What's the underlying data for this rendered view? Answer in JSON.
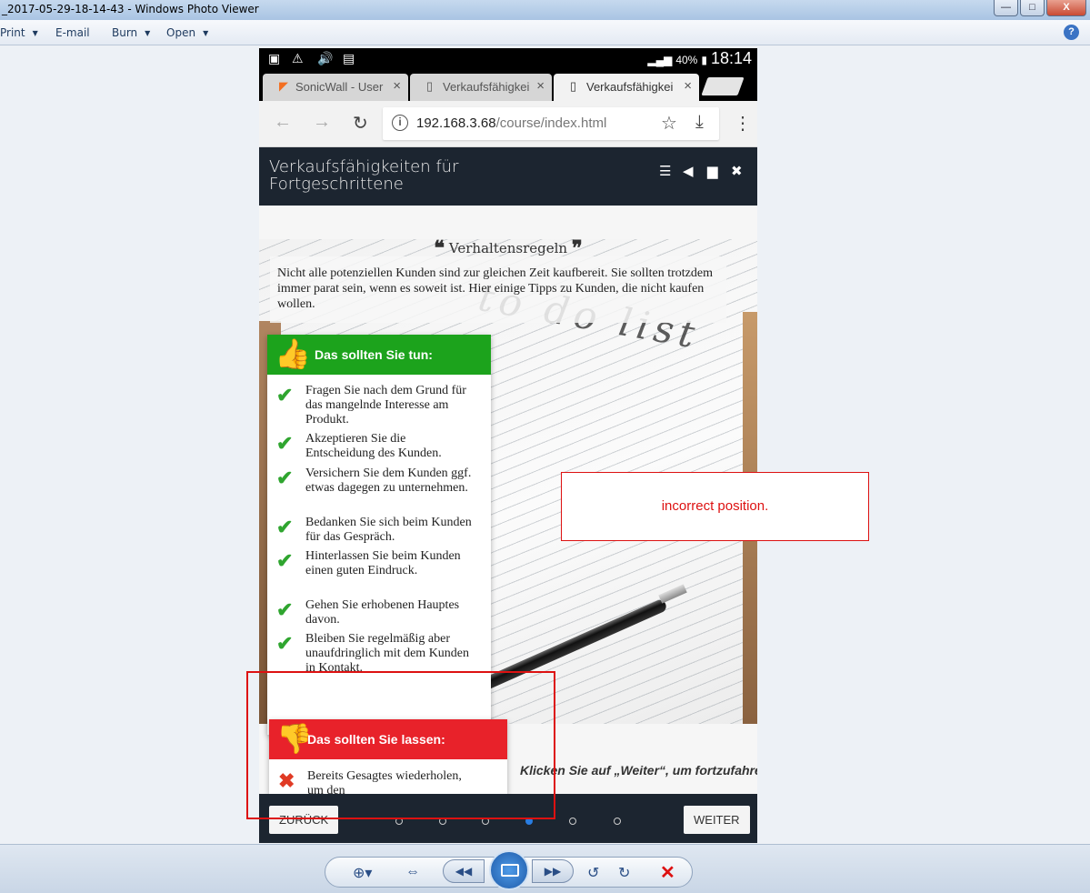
{
  "window": {
    "title": "_2017-05-29-18-14-43 - Windows Photo Viewer",
    "controls": {
      "minimize": "—",
      "maximize": "□",
      "close": "X"
    }
  },
  "menu": {
    "print": "Print",
    "email": "E-mail",
    "burn": "Burn",
    "open": "Open",
    "help": "?"
  },
  "phone": {
    "status": {
      "battery": "40%",
      "time": "18:14"
    },
    "tabs": [
      {
        "label": "SonicWall - User",
        "close": "×"
      },
      {
        "label": "Verkaufsfähigkei",
        "close": "×"
      },
      {
        "label": "Verkaufsfähigkei",
        "close": "×"
      }
    ],
    "address": {
      "host": "192.168.3.68",
      "path": "/course/index.html",
      "info": "i"
    },
    "course": {
      "title": "Verkaufsfähigkeiten für Fortgeschrittene",
      "quote_title": "Verhaltensregeln",
      "quote_open": "❝",
      "quote_close": "❞",
      "intro": "Nicht alle potenziellen Kunden sind zur gleichen Zeit kaufbereit. Sie sollten trotzdem immer parat sein, wenn es soweit ist. Hier einige Tipps zu Kunden, die nicht kaufen wollen.",
      "background_text": "to do list",
      "do_title": "Das sollten Sie tun:",
      "do_items": [
        "Fragen Sie nach dem Grund für das mangelnde Interesse am Produkt.",
        "Akzeptieren Sie die Entscheidung des Kunden.",
        "Versichern Sie dem Kunden ggf. etwas dagegen zu unternehmen.",
        "Bedanken Sie sich beim Kunden für das Gespräch.",
        "Hinterlassen Sie beim Kunden einen guten Eindruck.",
        "Gehen Sie erhobenen Hauptes davon.",
        "Bleiben Sie regelmäßig aber unaufdringlich mit dem Kunden in Kontakt."
      ],
      "dont_title": "Das sollten Sie lassen:",
      "dont_items": [
        "Bereits Gesagtes wiederholen, um den"
      ],
      "hint": "Klicken Sie auf „Weiter“, um fortzufahren.",
      "back_label": "ZURÜCK",
      "next_label": "WEITER",
      "progress": {
        "total": 6,
        "current": 4
      }
    }
  },
  "annotation": {
    "text": "incorrect position."
  },
  "colors": {
    "do_header": "#1ca31c",
    "dont_header": "#e8222a",
    "course_header": "#1c2530",
    "annotation": "#dd1111"
  }
}
